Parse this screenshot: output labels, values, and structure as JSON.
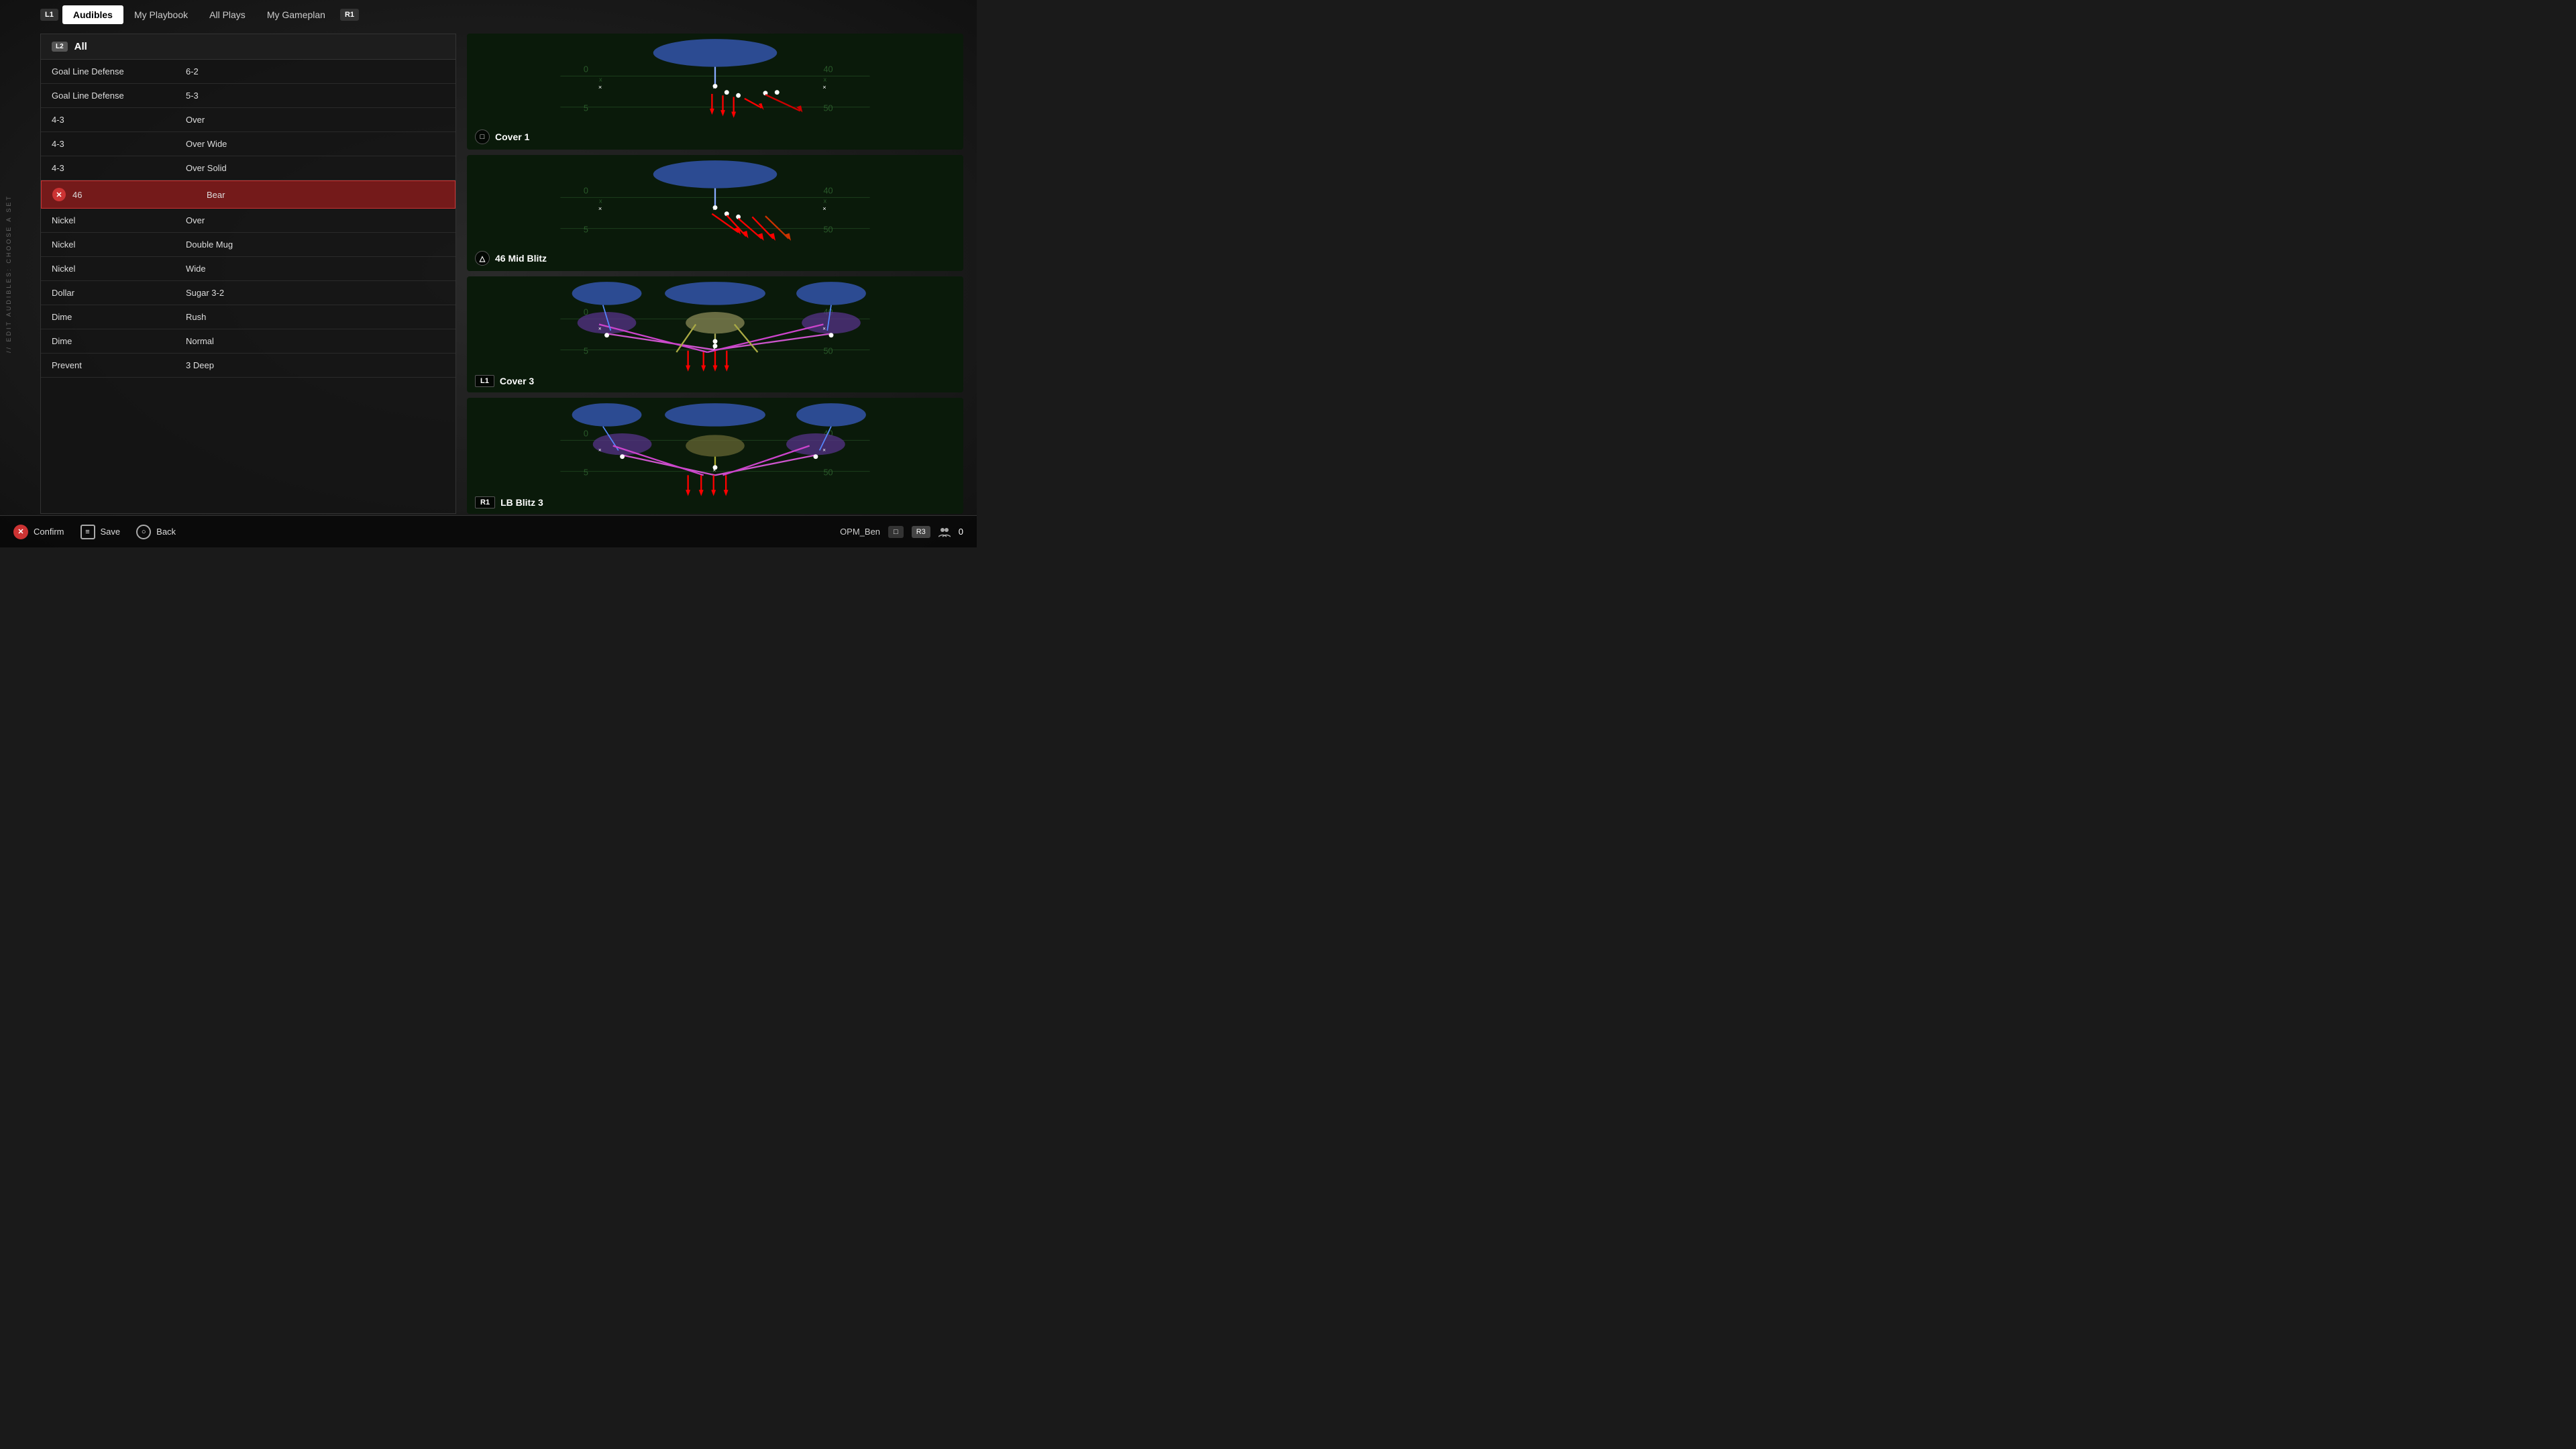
{
  "app": {
    "title": "Audibles",
    "side_label": "// EDIT AUDIBLES: CHOOSE A SET"
  },
  "nav": {
    "left_badge": "L1",
    "right_badge": "R1",
    "tabs": [
      {
        "label": "Audibles",
        "active": true
      },
      {
        "label": "My Playbook",
        "active": false
      },
      {
        "label": "All Plays",
        "active": false
      },
      {
        "label": "My Gameplan",
        "active": false
      }
    ]
  },
  "playList": {
    "header_badge": "L2",
    "header_label": "All",
    "items": [
      {
        "id": 1,
        "formation": "Goal Line Defense",
        "play": "6-2",
        "selected": false
      },
      {
        "id": 2,
        "formation": "Goal Line Defense",
        "play": "5-3",
        "selected": false
      },
      {
        "id": 3,
        "formation": "4-3",
        "play": "Over",
        "selected": false
      },
      {
        "id": 4,
        "formation": "4-3",
        "play": "Over Wide",
        "selected": false
      },
      {
        "id": 5,
        "formation": "4-3",
        "play": "Over Solid",
        "selected": false
      },
      {
        "id": 6,
        "formation": "46",
        "play": "Bear",
        "selected": true
      },
      {
        "id": 7,
        "formation": "Nickel",
        "play": "Over",
        "selected": false
      },
      {
        "id": 8,
        "formation": "Nickel",
        "play": "Double Mug",
        "selected": false
      },
      {
        "id": 9,
        "formation": "Nickel",
        "play": "Wide",
        "selected": false
      },
      {
        "id": 10,
        "formation": "Dollar",
        "play": "Sugar 3-2",
        "selected": false
      },
      {
        "id": 11,
        "formation": "Dime",
        "play": "Rush",
        "selected": false
      },
      {
        "id": 12,
        "formation": "Dime",
        "play": "Normal",
        "selected": false
      },
      {
        "id": 13,
        "formation": "Prevent",
        "play": "3 Deep",
        "selected": false
      }
    ]
  },
  "playCards": [
    {
      "id": 1,
      "badge": "□",
      "badge_type": "square",
      "name": "Cover 1",
      "position": "top"
    },
    {
      "id": 2,
      "badge": "△",
      "badge_type": "triangle",
      "name": "46 Mid Blitz",
      "position": "upper-mid"
    },
    {
      "id": 3,
      "badge": "L1",
      "badge_type": "l1",
      "name": "Cover 3",
      "position": "lower-mid"
    },
    {
      "id": 4,
      "badge": "R1",
      "badge_type": "r1",
      "name": "LB Blitz 3",
      "position": "bottom"
    }
  ],
  "bottomBar": {
    "actions": [
      {
        "id": "confirm",
        "icon": "X",
        "icon_type": "x",
        "label": "Confirm"
      },
      {
        "id": "save",
        "icon": "≡",
        "icon_type": "square",
        "label": "Save"
      },
      {
        "id": "back",
        "icon": "○",
        "icon_type": "circle",
        "label": "Back"
      }
    ],
    "username": "OPM_Ben",
    "controller_badge": "□",
    "r3_badge": "R3",
    "friends_count": "0"
  }
}
